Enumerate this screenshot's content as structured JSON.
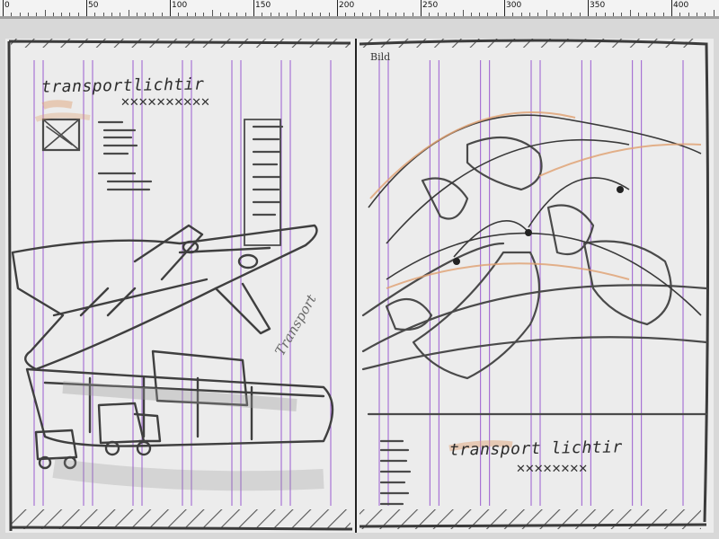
{
  "ruler": {
    "labels": [
      "0",
      "50",
      "100",
      "150",
      "200",
      "250",
      "300",
      "350",
      "400"
    ]
  },
  "spread": {
    "left_page": {
      "headline": "transportlichtir",
      "stars": "✕✕✕✕✕✕✕✕✕✕",
      "stamp": "Transport"
    },
    "right_page": {
      "image_label": "Bild",
      "headline": "transport lichtir",
      "stars": "✕✕✕✕✕✕✕✕"
    }
  },
  "colors": {
    "guide": "#9a5bd0",
    "pencil": "#4a4a4a",
    "highlight": "#e0a070",
    "paper": "#ececec"
  }
}
